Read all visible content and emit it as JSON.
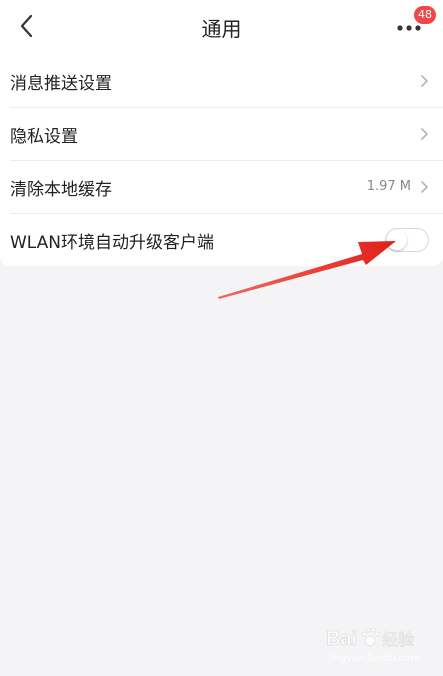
{
  "header": {
    "title": "通用",
    "badge_count": "48"
  },
  "settings": [
    {
      "label": "消息推送设置",
      "value": ""
    },
    {
      "label": "隐私设置",
      "value": ""
    },
    {
      "label": "清除本地缓存",
      "value": "1.97 M"
    },
    {
      "label": "WLAN环境自动升级客户端",
      "value": ""
    }
  ],
  "toggle": {
    "on": false
  },
  "annotation": {
    "arrow_color": "#e8231d"
  },
  "watermark": {
    "logo_text": "Bai 经验",
    "url": "jingyan.baidu.com"
  },
  "colors": {
    "background": "#f4f4f6",
    "badge": "#f04848",
    "text": "#222222",
    "secondary_text": "#888888"
  }
}
